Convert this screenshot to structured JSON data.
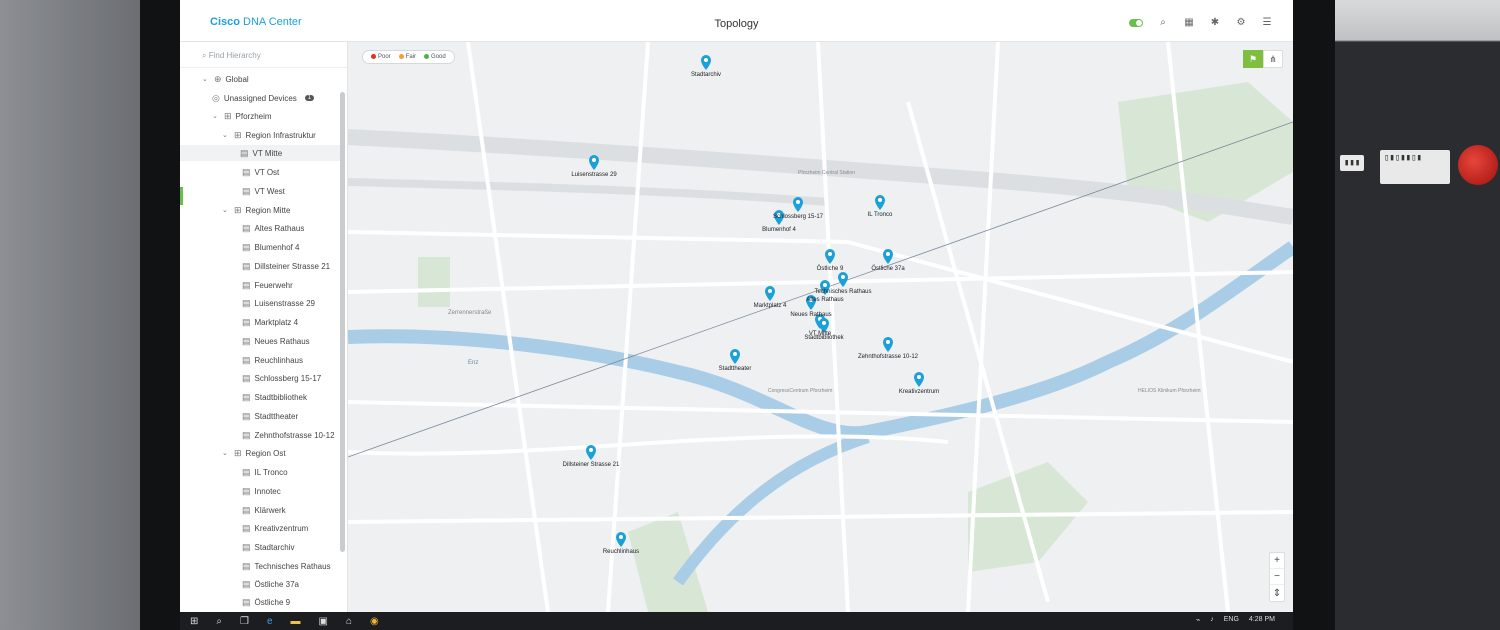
{
  "app": {
    "brand_bold": "Cisco",
    "brand_rest": " DNA Center",
    "title": "Topology"
  },
  "sidebar": {
    "search_placeholder": "Find Hierarchy",
    "items": [
      {
        "label": "Global"
      },
      {
        "label": "Unassigned Devices",
        "badge": "1"
      },
      {
        "label": "Pforzheim"
      },
      {
        "label": "Region Infrastruktur"
      },
      {
        "label": "VT Mitte"
      },
      {
        "label": "VT Ost"
      },
      {
        "label": "VT West"
      },
      {
        "label": "Region Mitte"
      },
      {
        "label": "Altes Rathaus"
      },
      {
        "label": "Blumenhof 4"
      },
      {
        "label": "Dillsteiner Strasse 21"
      },
      {
        "label": "Feuerwehr"
      },
      {
        "label": "Luisenstrasse 29"
      },
      {
        "label": "Marktplatz 4"
      },
      {
        "label": "Neues Rathaus"
      },
      {
        "label": "Reuchlinhaus"
      },
      {
        "label": "Schlossberg 15-17"
      },
      {
        "label": "Stadtbibliothek"
      },
      {
        "label": "Stadttheater"
      },
      {
        "label": "Zehnthofstrasse 10-12"
      },
      {
        "label": "Region Ost"
      },
      {
        "label": "IL Tronco"
      },
      {
        "label": "Innotec"
      },
      {
        "label": "Klärwerk"
      },
      {
        "label": "Kreativzentrum"
      },
      {
        "label": "Stadtarchiv"
      },
      {
        "label": "Technisches Rathaus"
      },
      {
        "label": "Östliche 37a"
      },
      {
        "label": "Östliche 9"
      }
    ]
  },
  "legend": {
    "poor": "Poor",
    "fair": "Fair",
    "good": "Good",
    "poor_color": "#e0301e",
    "fair_color": "#f0a030",
    "good_color": "#4caf50"
  },
  "pins": [
    {
      "label": "Stadtarchiv"
    },
    {
      "label": "Luisenstrasse 29"
    },
    {
      "label": "Schlossberg 15-17"
    },
    {
      "label": "Blumenhof 4"
    },
    {
      "label": "IL Tronco"
    },
    {
      "label": "Östliche 9"
    },
    {
      "label": "Östliche 37a"
    },
    {
      "label": "Technisches Rathaus"
    },
    {
      "label": "Altes Rathaus"
    },
    {
      "label": "Marktplatz 4"
    },
    {
      "label": "Neues Rathaus"
    },
    {
      "label": "VT Mitte"
    },
    {
      "label": "Stadtbibliothek"
    },
    {
      "label": "Zehnthofstrasse 10-12"
    },
    {
      "label": "Stadttheater"
    },
    {
      "label": "Kreativzentrum"
    },
    {
      "label": "Dillsteiner Strasse 21"
    },
    {
      "label": "Reuchlinhaus"
    }
  ],
  "map_labels": {
    "zerrennerstrasse": "Zerrennerstraße",
    "enz": "Enz",
    "central": "Pforzheim Central Station",
    "congress": "CongressCentrum Pforzheim",
    "helios": "HELIOS Klinikum Pforzheim"
  },
  "taskbar": {
    "time": "4:28 PM",
    "lang": "ENG"
  },
  "accent_color": "#1ba0d7"
}
